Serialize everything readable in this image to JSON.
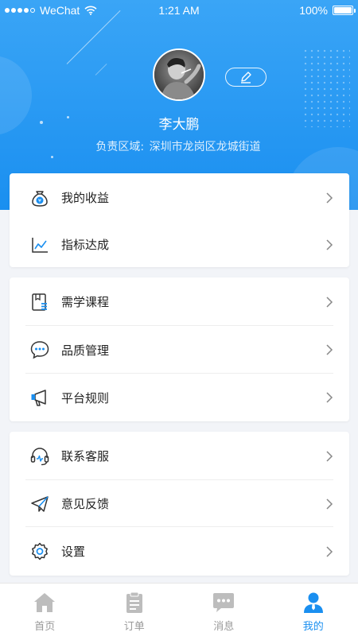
{
  "status_bar": {
    "carrier": "WeChat",
    "time": "1:21 AM",
    "battery": "100%",
    "battery_level": 1.0
  },
  "profile": {
    "name": "李大鹏",
    "region_label": "负责区域:",
    "region_value": "深圳市龙岗区龙城街道"
  },
  "menu_groups": [
    {
      "items": [
        {
          "label": "我的收益",
          "icon": "money-bag-icon"
        },
        {
          "label": "指标达成",
          "icon": "line-chart-icon"
        }
      ]
    },
    {
      "items": [
        {
          "label": "需学课程",
          "icon": "book-icon"
        },
        {
          "label": "品质管理",
          "icon": "chat-bubble-icon"
        },
        {
          "label": "平台规则",
          "icon": "megaphone-icon"
        }
      ]
    },
    {
      "items": [
        {
          "label": "联系客服",
          "icon": "headset-icon"
        },
        {
          "label": "意见反馈",
          "icon": "paper-plane-icon"
        },
        {
          "label": "设置",
          "icon": "gear-icon"
        }
      ]
    }
  ],
  "tabs": [
    {
      "label": "首页",
      "icon": "home-icon",
      "active": false
    },
    {
      "label": "订单",
      "icon": "clipboard-icon",
      "active": false
    },
    {
      "label": "消息",
      "icon": "message-icon",
      "active": false
    },
    {
      "label": "我的",
      "icon": "person-icon",
      "active": true
    }
  ],
  "colors": {
    "brand_blue": "#1a8ff0",
    "header_gradient_top": "#3aa5f6",
    "tab_inactive": "#bdbdbd",
    "background": "#f2f4f8"
  }
}
